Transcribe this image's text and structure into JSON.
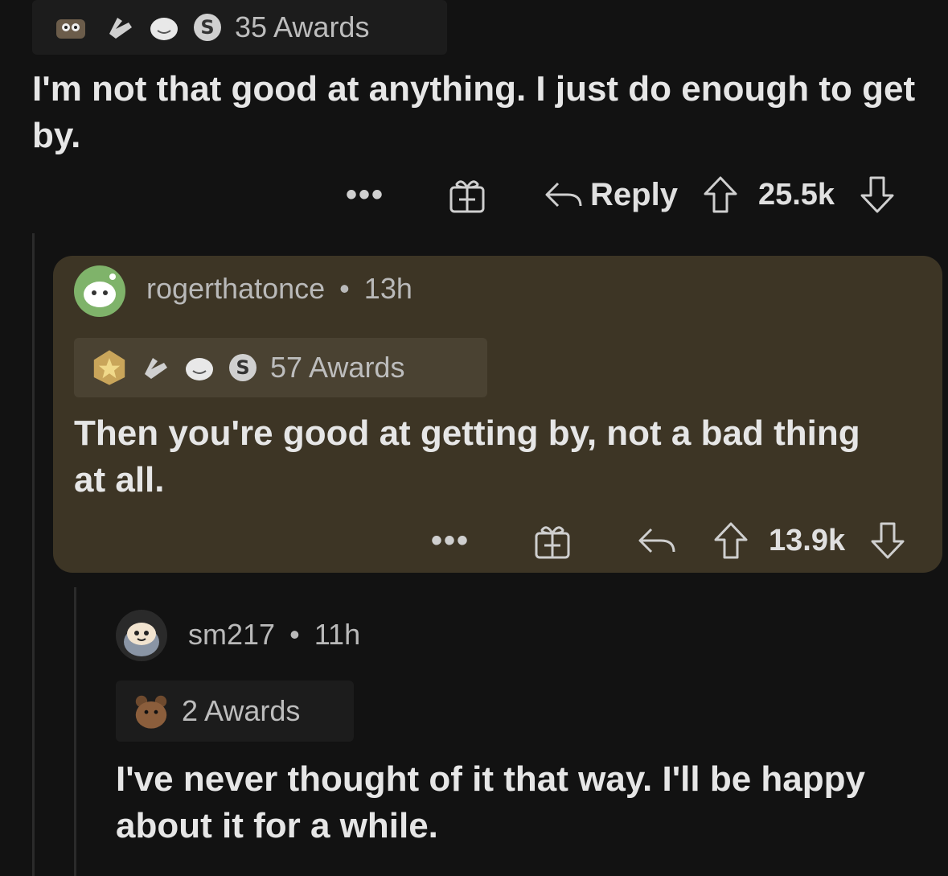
{
  "top_comment": {
    "awards_count": "35 Awards",
    "body": "I'm not that good at anything. I just do enough to get by.",
    "reply_label": "Reply",
    "score": "25.5k"
  },
  "reply_1": {
    "username": "rogerthatonce",
    "time": "13h",
    "awards_count": "57 Awards",
    "body": "Then you're good at getting by, not a bad thing at all.",
    "score": "13.9k"
  },
  "reply_2": {
    "username": "sm217",
    "time": "11h",
    "awards_count": "2 Awards",
    "body": "I've never thought of it that way. I'll be happy about it for a while."
  },
  "separator": "•",
  "more_label": "•••",
  "colors": {
    "background": "#121212",
    "highlight_card": "#3d3525",
    "awards_box": "#1c1c1c"
  },
  "icons": [
    "more-icon",
    "gift-icon",
    "reply-arrow-icon",
    "upvote-arrow-icon",
    "downvote-arrow-icon",
    "silver-award-icon",
    "wholesome-award-icon",
    "helpful-award-icon"
  ]
}
